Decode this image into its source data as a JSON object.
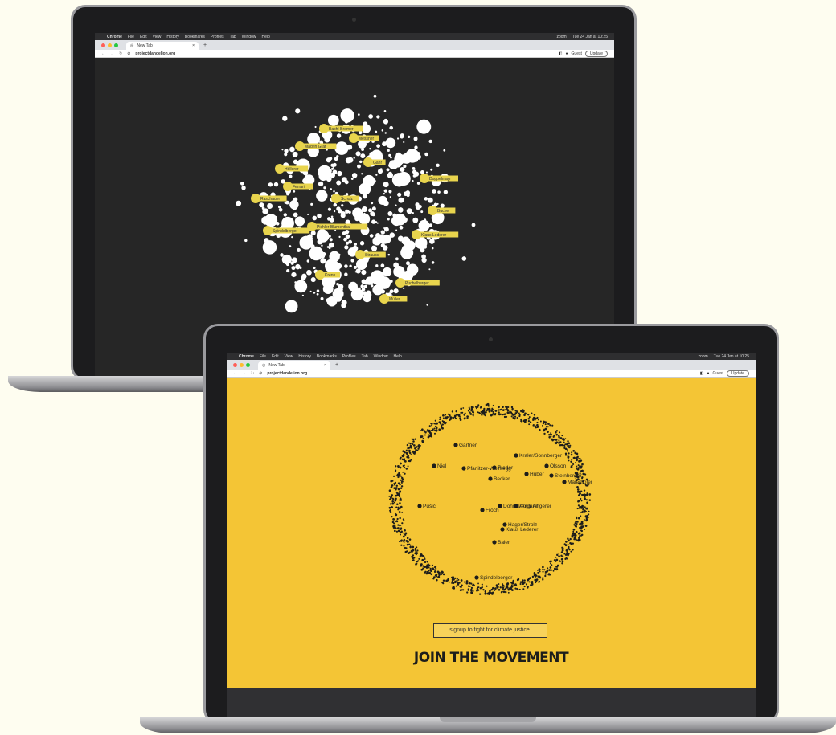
{
  "system": {
    "apple_menu": "",
    "menu_items": [
      "Chrome",
      "File",
      "Edit",
      "View",
      "History",
      "Bookmarks",
      "Profiles",
      "Tab",
      "Window",
      "Help"
    ],
    "status_items": [
      "zoom",
      "Tue 24 Jan at 10:25"
    ]
  },
  "browser": {
    "tab_title": "New Tab",
    "tab_close": "×",
    "new_tab": "+",
    "url": "projectdandelion.org",
    "profile_label": "Guest",
    "update_label": "Update"
  },
  "colors": {
    "yellow": "#f4c535",
    "dark": "#262626",
    "bubble": "#ffffff",
    "bubble_highlight": "#e8d44d",
    "dot": "#1d1d1b"
  },
  "dark_labels": [
    "Bachl-Bremer",
    "Madrin Graf",
    "Messner",
    "Höllerer",
    "Gahr",
    "Doppelmayr",
    "Ferrari",
    "Scholz",
    "Raschauer",
    "Bucher",
    "Spindelberger",
    "Pichler-Blumenthal",
    "Klaus Lederer",
    "Strauss",
    "Krenn",
    "Puchelberger",
    "Müller"
  ],
  "yellow_labels": [
    "Gartner",
    "Niel",
    "Pfanitzer-Wolfsegg",
    "Kraler/Sonnberger",
    "Rieder",
    "Olsson",
    "Huber",
    "Steinberger",
    "Maierhofer",
    "Becker",
    "Pušić",
    "Fröch",
    "Dohnal/Angl Angerer",
    "Anglarill",
    "Hager/Strolz",
    "Klaus Lederer",
    "Baler",
    "Spindelberger"
  ],
  "signup": {
    "cta_label": "signup to fight for climate justice.",
    "headline": "JOIN THE MOVEMENT"
  }
}
